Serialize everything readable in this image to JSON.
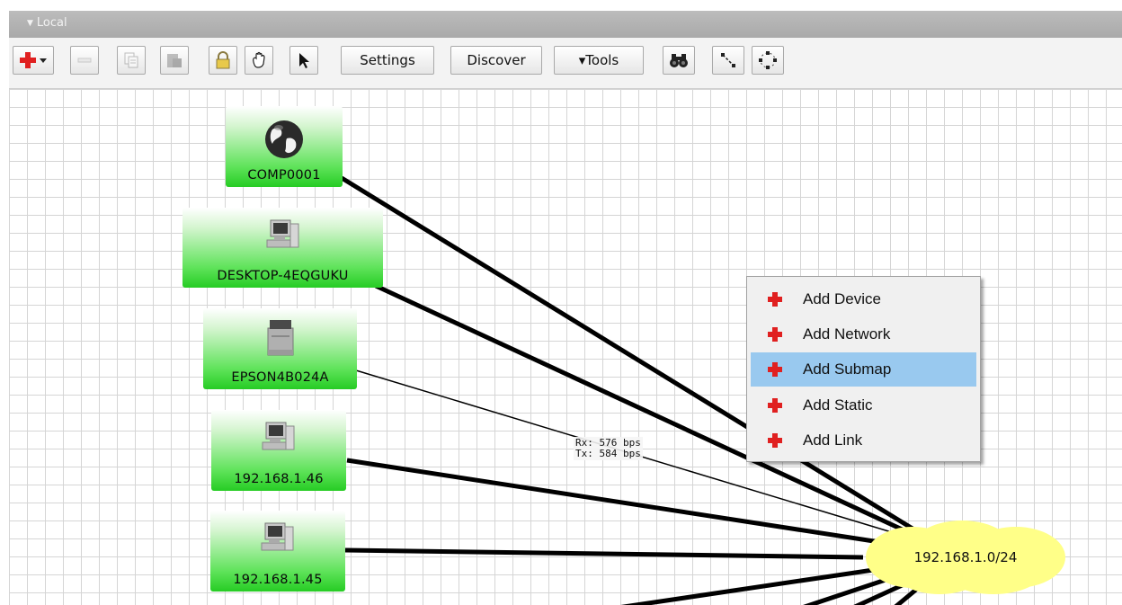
{
  "panel": {
    "title": "Local"
  },
  "toolbar": {
    "settings_label": "Settings",
    "discover_label": "Discover",
    "tools_label": "▾Tools",
    "icons": [
      "add-menu-icon",
      "remove-icon",
      "copy-icon",
      "paste-icon",
      "lock-icon",
      "hand-icon",
      "pointer-icon",
      "binoculars-icon",
      "link-icon",
      "circle-layout-icon"
    ]
  },
  "devices": [
    {
      "name": "COMP0001",
      "icon": "globe-icon"
    },
    {
      "name": "DESKTOP-4EQGUKU",
      "icon": "computer-icon"
    },
    {
      "name": "EPSON4B024A",
      "icon": "printer-icon"
    },
    {
      "name": "192.168.1.46",
      "icon": "computer-icon"
    },
    {
      "name": "192.168.1.45",
      "icon": "computer-icon"
    }
  ],
  "network": {
    "name": "192.168.1.0/24",
    "color": "#ffff88"
  },
  "link_traffic": {
    "rx": "Rx: 576 bps",
    "tx": "Tx: 584 bps"
  },
  "context_menu": {
    "items": [
      {
        "label": "Add Device",
        "highlighted": false
      },
      {
        "label": "Add Network",
        "highlighted": false
      },
      {
        "label": "Add Submap",
        "highlighted": true
      },
      {
        "label": "Add Static",
        "highlighted": false
      },
      {
        "label": "Add Link",
        "highlighted": false
      }
    ],
    "highlight_color": "#99c9ef"
  },
  "colors": {
    "node_green": "#26cc24",
    "add_red": "#e02020"
  }
}
